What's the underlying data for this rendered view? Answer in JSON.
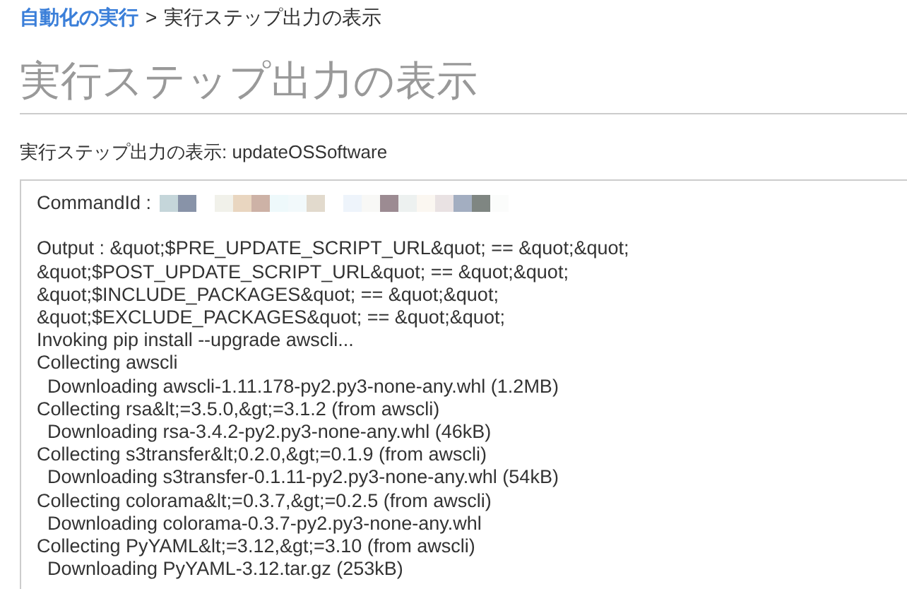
{
  "breadcrumb": {
    "link": "自動化の実行",
    "separator": ">",
    "current": "実行ステップ出力の表示"
  },
  "title": "実行ステップ出力の表示",
  "subtitle": "実行ステップ出力の表示: updateOSSoftware",
  "output": {
    "command_label": "CommandId :",
    "lines": [
      "Output : &quot;$PRE_UPDATE_SCRIPT_URL&quot; == &quot;&quot;",
      "&quot;$POST_UPDATE_SCRIPT_URL&quot; == &quot;&quot;",
      "&quot;$INCLUDE_PACKAGES&quot; == &quot;&quot;",
      "&quot;$EXCLUDE_PACKAGES&quot; == &quot;&quot;",
      "Invoking pip install --upgrade awscli...",
      "Collecting awscli",
      "  Downloading awscli-1.11.178-py2.py3-none-any.whl (1.2MB)",
      "Collecting rsa&lt;=3.5.0,&gt;=3.1.2 (from awscli)",
      "  Downloading rsa-3.4.2-py2.py3-none-any.whl (46kB)",
      "Collecting s3transfer&lt;0.2.0,&gt;=0.1.9 (from awscli)",
      "  Downloading s3transfer-0.1.11-py2.py3-none-any.whl (54kB)",
      "Collecting colorama&lt;=0.3.7,&gt;=0.2.5 (from awscli)",
      "  Downloading colorama-0.3.7-py2.py3-none-any.whl",
      "Collecting PyYAML&lt;=3.12,&gt;=3.10 (from awscli)",
      "  Downloading PyYAML-3.12.tar.gz (253kB)"
    ]
  }
}
